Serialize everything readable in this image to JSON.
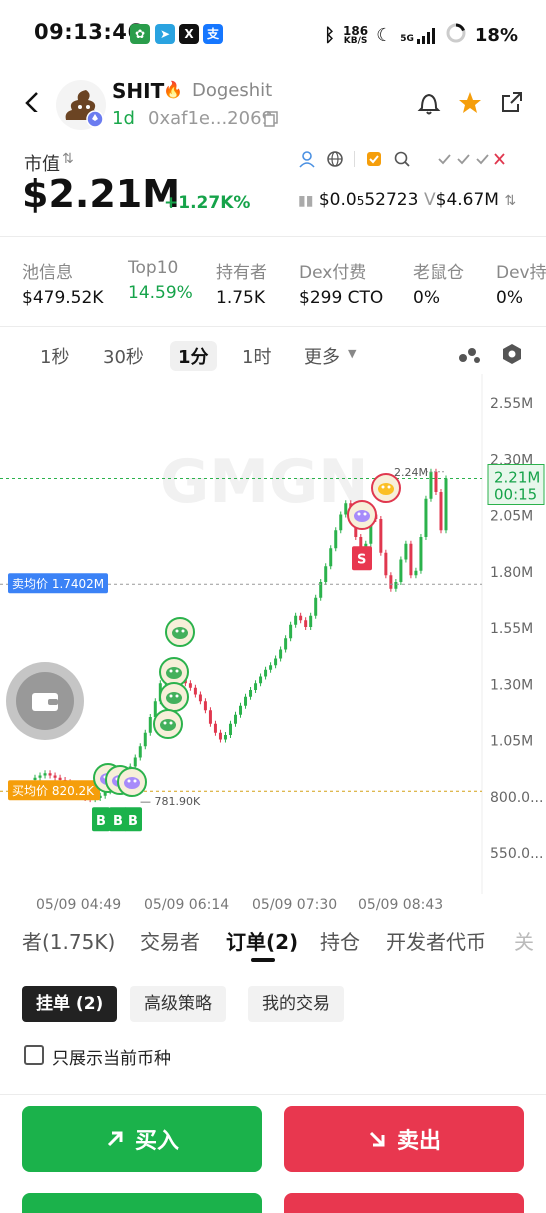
{
  "status_bar": {
    "time": "09:13:46",
    "net_speed_value": "186",
    "net_speed_unit": "KB/S",
    "signal_label": "5G",
    "battery": "18%"
  },
  "token": {
    "symbol": "SHIT",
    "name": "Dogeshit",
    "age": "1d",
    "address": "0xaf1e...2069"
  },
  "market": {
    "label": "市值",
    "value": "$2.21M",
    "change": "+1.27K%",
    "price_prefix": "$0.0",
    "price_sub": "5",
    "price_rest": "52723",
    "volume_prefix": "V",
    "volume": "$4.67M"
  },
  "stats": [
    {
      "label": "池信息",
      "value": "$479.52K"
    },
    {
      "label": "Top10",
      "value": "14.59%"
    },
    {
      "label": "持有者",
      "value": "1.75K"
    },
    {
      "label": "Dex付费",
      "value": "$299 CTO"
    },
    {
      "label": "老鼠仓",
      "value": "0%"
    },
    {
      "label": "Dev持",
      "value": "0%"
    }
  ],
  "timeframes": [
    "1秒",
    "30秒",
    "1分",
    "1时",
    "更多"
  ],
  "chart_data": {
    "type": "line",
    "watermark": "GMGN",
    "y_ticks": [
      "2.55M",
      "2.30M",
      "2.05M",
      "1.80M",
      "1.55M",
      "1.30M",
      "1.05M",
      "800.0...",
      "550.0..."
    ],
    "x_ticks": [
      "05/09 04:49",
      "05/09 06:14",
      "05/09 07:30",
      "05/09 08:43"
    ],
    "current_price_label": "2.21M",
    "countdown": "00:15",
    "high_label": "2.24M",
    "low_label": "781.90K",
    "sell_avg_label": "卖均价 1.7402M",
    "buy_avg_label": "买均价 820.2K",
    "buy_marker": "B",
    "sell_marker": "S",
    "series": [
      {
        "values": [
          0.87,
          0.88,
          0.89,
          0.9,
          0.89,
          0.88,
          0.87,
          0.86,
          0.84,
          0.82,
          0.8,
          0.79,
          0.785,
          0.79,
          0.8,
          0.82,
          0.84,
          0.86,
          0.88,
          0.9,
          0.93,
          0.97,
          1.02,
          1.08,
          1.15,
          1.22,
          1.3,
          1.36,
          1.38,
          1.35,
          1.32,
          1.3,
          1.28,
          1.25,
          1.22,
          1.18,
          1.12,
          1.08,
          1.05,
          1.07,
          1.12,
          1.16,
          1.2,
          1.24,
          1.27,
          1.3,
          1.33,
          1.36,
          1.38,
          1.41,
          1.45,
          1.5,
          1.56,
          1.6,
          1.58,
          1.55,
          1.6,
          1.68,
          1.75,
          1.82,
          1.9,
          1.98,
          2.05,
          2.1,
          2.08,
          1.95,
          1.85,
          1.92,
          2.05,
          2.03,
          1.88,
          1.78,
          1.72,
          1.75,
          1.85,
          1.92,
          1.78,
          1.8,
          1.95,
          2.12,
          2.24,
          2.15,
          1.98,
          2.21
        ]
      }
    ]
  },
  "order_tabs": [
    "者(1.75K)",
    "交易者",
    "订单(2)",
    "持仓",
    "开发者代币",
    "关"
  ],
  "sub_tabs": [
    "挂单 (2)",
    "高级策略",
    "我的交易"
  ],
  "checkbox_label": "只展示当前币种",
  "actions": {
    "buy": "买入",
    "sell": "卖出"
  },
  "colors": {
    "up": "#16a34a",
    "down": "#e0384f",
    "buy_button": "#1bb24b",
    "sell_button": "#e8374f",
    "sell_avg": "#3b82f6",
    "buy_avg": "#f59e0b"
  }
}
